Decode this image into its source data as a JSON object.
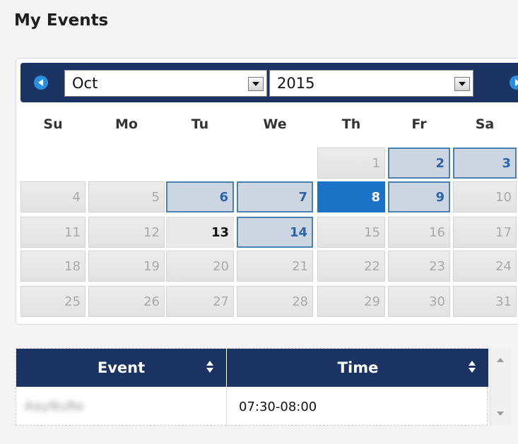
{
  "widget": {
    "title": "My Events"
  },
  "calendar": {
    "month": "Oct",
    "year": "2015",
    "weekdays": [
      "Su",
      "Mo",
      "Tu",
      "We",
      "Th",
      "Fr",
      "Sa"
    ],
    "days": [
      {
        "label": "1",
        "state": "other"
      },
      {
        "label": "2",
        "state": "event"
      },
      {
        "label": "3",
        "state": "event"
      },
      {
        "label": "4",
        "state": "other"
      },
      {
        "label": "5",
        "state": "other"
      },
      {
        "label": "6",
        "state": "event"
      },
      {
        "label": "7",
        "state": "event"
      },
      {
        "label": "8",
        "state": "selected"
      },
      {
        "label": "9",
        "state": "event"
      },
      {
        "label": "10",
        "state": "other"
      },
      {
        "label": "11",
        "state": "other"
      },
      {
        "label": "12",
        "state": "other"
      },
      {
        "label": "13",
        "state": "today"
      },
      {
        "label": "14",
        "state": "event"
      },
      {
        "label": "15",
        "state": "other"
      },
      {
        "label": "16",
        "state": "other"
      },
      {
        "label": "17",
        "state": "other"
      },
      {
        "label": "18",
        "state": "other"
      },
      {
        "label": "19",
        "state": "other"
      },
      {
        "label": "20",
        "state": "other"
      },
      {
        "label": "21",
        "state": "other"
      },
      {
        "label": "22",
        "state": "other"
      },
      {
        "label": "23",
        "state": "other"
      },
      {
        "label": "24",
        "state": "other"
      },
      {
        "label": "25",
        "state": "other"
      },
      {
        "label": "26",
        "state": "other"
      },
      {
        "label": "27",
        "state": "other"
      },
      {
        "label": "28",
        "state": "other"
      },
      {
        "label": "29",
        "state": "other"
      },
      {
        "label": "30",
        "state": "other"
      },
      {
        "label": "31",
        "state": "other"
      }
    ]
  },
  "events_table": {
    "columns": [
      "Event",
      "Time"
    ],
    "rows": [
      {
        "event": "AayNuRe",
        "time": "07:30-08:00"
      }
    ]
  },
  "colors": {
    "header_navy": "#1b3463",
    "selected_blue": "#1b73c8",
    "event_day_text": "#2b64ad",
    "nav_button_blue": "#2a8fe0"
  }
}
